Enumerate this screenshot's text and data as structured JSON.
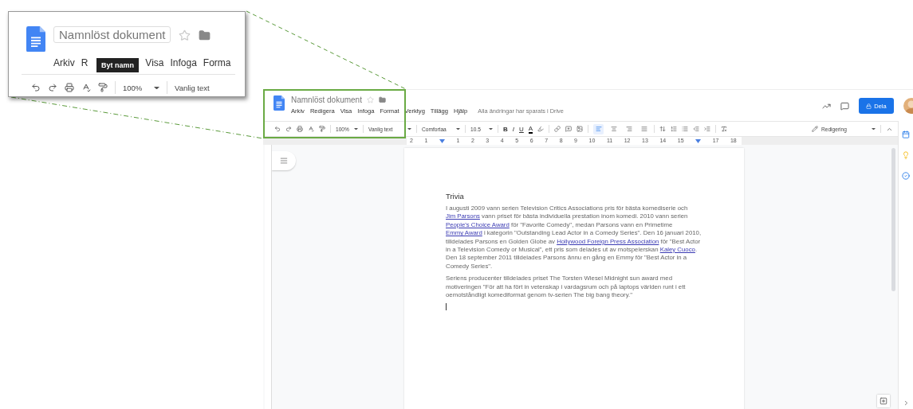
{
  "callout": {
    "title": "Namnlöst dokument",
    "starred": false,
    "menu": [
      "Arkiv",
      "R",
      "Visa",
      "Infoga",
      "Forma"
    ],
    "tooltip": "Byt namn",
    "zoom": "100%",
    "paragraph_style": "Vanlig text"
  },
  "doc": {
    "title": "Namnlöst dokument",
    "starred": false,
    "menu": [
      "Arkiv",
      "Redigera",
      "Visa",
      "Infoga",
      "Format",
      "Verktyg",
      "Tillägg",
      "Hjälp"
    ],
    "save_status": "Alla ändringar har sparats i Drive",
    "share_button": "Dela"
  },
  "toolbar": {
    "zoom": "100%",
    "paragraph_style": "Vanlig text",
    "font": "Comfortaa",
    "font_size": "10.5",
    "format_buttons": [
      "B",
      "I",
      "U",
      "A"
    ],
    "alignments": [
      {
        "kind": "left",
        "selected": true
      },
      {
        "kind": "center",
        "selected": false
      },
      {
        "kind": "right",
        "selected": false
      },
      {
        "kind": "justify",
        "selected": false
      }
    ],
    "mode": "Redigering"
  },
  "ruler": [
    {
      "kind": "number",
      "label": "2"
    },
    {
      "kind": "number",
      "label": "1"
    },
    {
      "kind": "indent"
    },
    {
      "kind": "number",
      "label": "1"
    },
    {
      "kind": "number",
      "label": "2"
    },
    {
      "kind": "number",
      "label": "3"
    },
    {
      "kind": "number",
      "label": "4"
    },
    {
      "kind": "number",
      "label": "5"
    },
    {
      "kind": "number",
      "label": "6"
    },
    {
      "kind": "number",
      "label": "7"
    },
    {
      "kind": "number",
      "label": "8"
    },
    {
      "kind": "number",
      "label": "9"
    },
    {
      "kind": "number",
      "label": "10"
    },
    {
      "kind": "number",
      "label": "11"
    },
    {
      "kind": "number",
      "label": "12"
    },
    {
      "kind": "number",
      "label": "13"
    },
    {
      "kind": "number",
      "label": "14"
    },
    {
      "kind": "number",
      "label": "15"
    },
    {
      "kind": "indent"
    },
    {
      "kind": "number",
      "label": "17"
    },
    {
      "kind": "number",
      "label": "18"
    }
  ],
  "document": {
    "heading": "Trivia",
    "paragraphs": [
      [
        {
          "kind": "text",
          "text": "I augusti 2009 vann serien Television Critics Associations pris för bästa komediserie och "
        },
        {
          "kind": "link",
          "text": "Jim Parsons"
        },
        {
          "kind": "text",
          "text": " vann priset för bästa individuella prestation inom komedi. 2010 vann serien "
        },
        {
          "kind": "link",
          "text": "People's Choice Award"
        },
        {
          "kind": "text",
          "text": " för \"Favorite Comedy\", medan Parsons vann en Primetime "
        },
        {
          "kind": "link",
          "text": "Emmy Award"
        },
        {
          "kind": "text",
          "text": " i kategorin \"Outstanding Lead Actor in a Comedy Series\". Den 16 januari 2010, tilldelades Parsons en Golden Globe av "
        },
        {
          "kind": "link",
          "text": "Hollywood Foreign Press Association"
        },
        {
          "kind": "text",
          "text": " för \"Best Actor in a Television Comedy or Musical\", ett pris som delades ut av motspelerskan "
        },
        {
          "kind": "link",
          "text": "Kaley Cuoco"
        },
        {
          "kind": "text",
          "text": ". Den 18 september 2011 tilldelades Parsons ännu en gång en Emmy för \"Best Actor in a Comedy Series\"."
        }
      ],
      [
        {
          "kind": "text",
          "text": "Seriens producenter tilldelades priset The Torsten Wiesel Midnight sun award med motiveringen \"För att ha fört in vetenskap i vardagsrum och på laptops världen runt i ett oemotståndligt komediformat genom tv-serien The big bang theory.\""
        }
      ]
    ]
  }
}
